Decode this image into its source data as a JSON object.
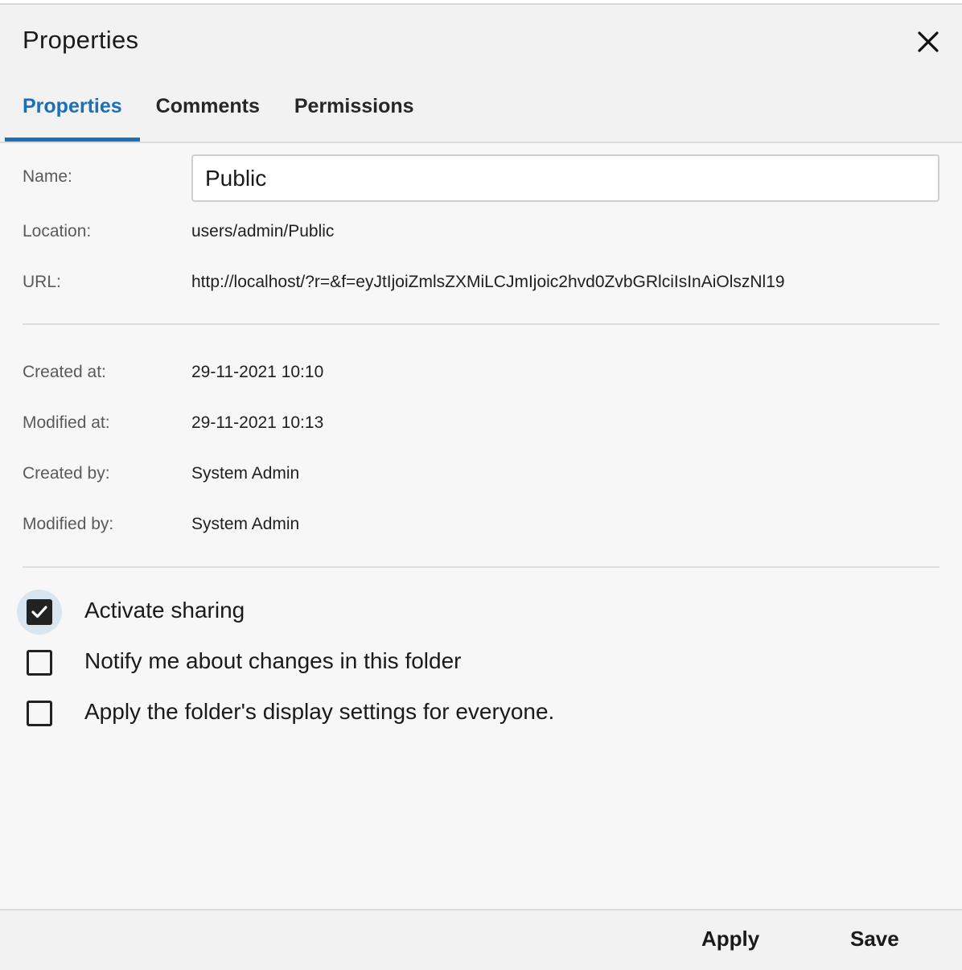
{
  "dialog": {
    "title": "Properties",
    "close_icon": "close-icon"
  },
  "tabs": [
    {
      "label": "Properties",
      "active": true
    },
    {
      "label": "Comments",
      "active": false
    },
    {
      "label": "Permissions",
      "active": false
    }
  ],
  "fields": {
    "name": {
      "label": "Name:",
      "value": "Public"
    },
    "location": {
      "label": "Location:",
      "value": "users/admin/Public"
    },
    "url": {
      "label": "URL:",
      "value": "http://localhost/?r=&f=eyJtIjoiZmlsZXMiLCJmIjoic2hvd0ZvbGRlciIsInAiOlszNl19"
    },
    "created_at": {
      "label": "Created at:",
      "value": "29-11-2021 10:10"
    },
    "modified_at": {
      "label": "Modified at:",
      "value": "29-11-2021 10:13"
    },
    "created_by": {
      "label": "Created by:",
      "value": "System Admin"
    },
    "modified_by": {
      "label": "Modified by:",
      "value": "System Admin"
    }
  },
  "options": [
    {
      "label": "Activate sharing",
      "checked": true
    },
    {
      "label": "Notify me about changes in this folder",
      "checked": false
    },
    {
      "label": "Apply the folder's display settings for everyone.",
      "checked": false
    }
  ],
  "footer": {
    "apply_label": "Apply",
    "save_label": "Save"
  },
  "colors": {
    "accent": "#1a6fb8",
    "checkbox_focus": "#d9e6f0"
  }
}
